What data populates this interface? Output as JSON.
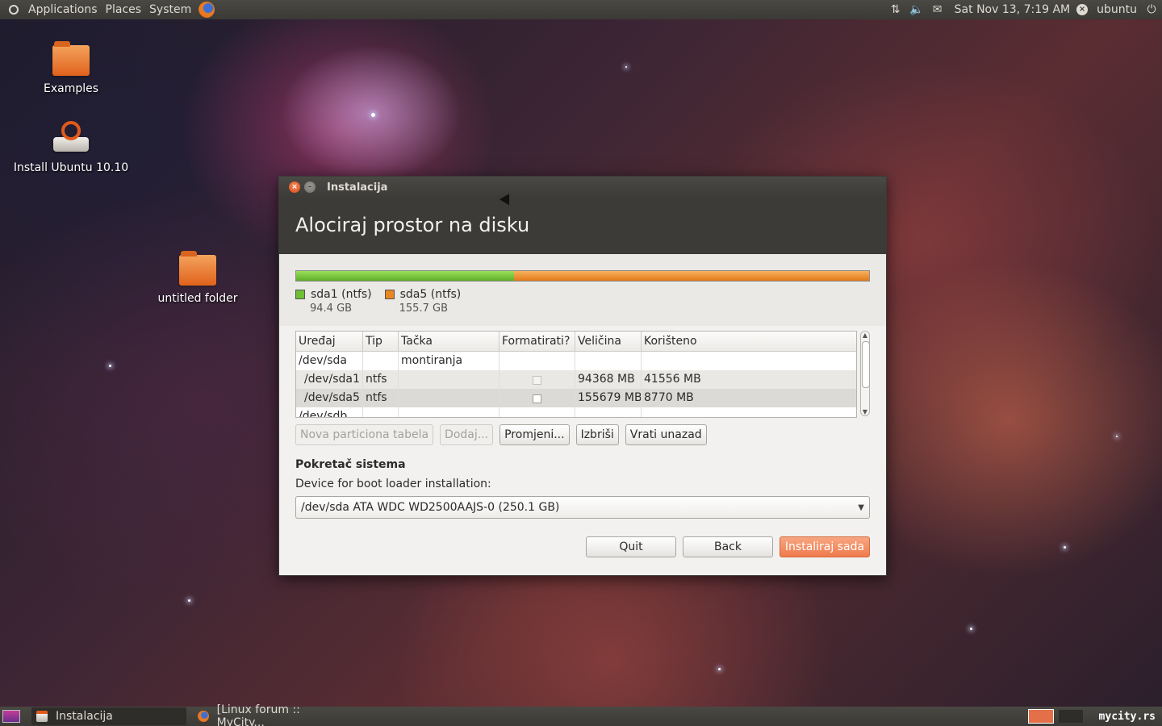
{
  "top_panel": {
    "menus": [
      "Applications",
      "Places",
      "System"
    ],
    "clock": "Sat Nov 13, 7:19 AM",
    "user": "ubuntu"
  },
  "desktop": {
    "icons": [
      {
        "label": "Examples"
      },
      {
        "label": "Install Ubuntu 10.10"
      },
      {
        "label": "untitled folder"
      }
    ]
  },
  "window": {
    "title": "Instalacija",
    "heading": "Alociraj prostor na disku",
    "partitions_legend": [
      {
        "name": "sda1 (ntfs)",
        "size": "94.4 GB",
        "color": "#6ebf34"
      },
      {
        "name": "sda5 (ntfs)",
        "size": "155.7 GB",
        "color": "#e98724"
      }
    ],
    "table": {
      "columns": [
        "Uređaj",
        "Tip",
        "Tačka montiranja",
        "Formatirati?",
        "Veličina",
        "Korišteno"
      ],
      "rows": [
        {
          "device": "/dev/sda",
          "type": "",
          "mount": "",
          "size": "",
          "used": ""
        },
        {
          "device": "/dev/sda1",
          "type": "ntfs",
          "mount": "",
          "size": "94368 MB",
          "used": "41556 MB"
        },
        {
          "device": "/dev/sda5",
          "type": "ntfs",
          "mount": "",
          "size": "155679 MB",
          "used": "8770 MB"
        },
        {
          "device": "/dev/sdb",
          "type": "",
          "mount": "",
          "size": "",
          "used": ""
        }
      ]
    },
    "table_buttons": {
      "new_table": "Nova particiona tabela",
      "add": "Dodaj...",
      "change": "Promjeni...",
      "delete": "Izbriši",
      "revert": "Vrati unazad"
    },
    "boot": {
      "title": "Pokretač sistema",
      "label": "Device for boot loader installation:",
      "selected": "/dev/sda ATA WDC WD2500AAJS-0 (250.1 GB)"
    },
    "footer": {
      "quit": "Quit",
      "back": "Back",
      "install": "Instaliraj sada"
    }
  },
  "bottom_panel": {
    "tasks": [
      "Instalacija",
      "[Linux forum :: MyCity..."
    ],
    "watermark": "mycity.rs"
  }
}
